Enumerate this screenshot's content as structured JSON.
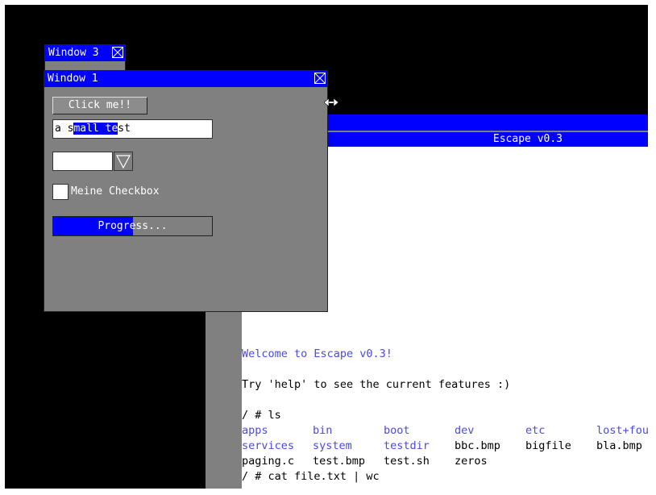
{
  "window3": {
    "title": "Window 3"
  },
  "window1": {
    "title": "Window 1",
    "button_label": "Click me!!",
    "textfield": {
      "before": "a s",
      "selected": "mall te",
      "after": "st"
    },
    "checkbox_label": "Meine Checkbox",
    "progress": {
      "label": "Progress...",
      "fraction": 0.5
    }
  },
  "terminal": {
    "title": "Escape v0.3",
    "welcome": "Welcome to Escape v0.3!",
    "help_line": "Try 'help' to see the current features :)",
    "prompt1": "/ # ls",
    "ls_rows": [
      [
        {
          "t": "apps",
          "dir": true
        },
        {
          "t": "bin",
          "dir": true
        },
        {
          "t": "boot",
          "dir": true
        },
        {
          "t": "dev",
          "dir": true
        },
        {
          "t": "etc",
          "dir": true
        },
        {
          "t": "lost+fou",
          "dir": true
        }
      ],
      [
        {
          "t": "services",
          "dir": true
        },
        {
          "t": "system",
          "dir": true
        },
        {
          "t": "testdir",
          "dir": true
        },
        {
          "t": "bbc.bmp",
          "dir": false
        },
        {
          "t": "bigfile",
          "dir": false
        },
        {
          "t": "bla.bmp",
          "dir": false
        }
      ],
      [
        {
          "t": "paging.c",
          "dir": false
        },
        {
          "t": "test.bmp",
          "dir": false
        },
        {
          "t": "test.sh",
          "dir": false
        },
        {
          "t": "zeros",
          "dir": false
        }
      ]
    ],
    "prompt2": "/ # cat file.txt | wc"
  },
  "colors": {
    "titlebar": "#0000ff",
    "window_bg": "#808080",
    "desktop": "#000000",
    "dir_text": "#4a4ae0"
  },
  "icons": [
    "close-icon",
    "dropdown-arrow-icon",
    "resize-cursor-icon"
  ]
}
